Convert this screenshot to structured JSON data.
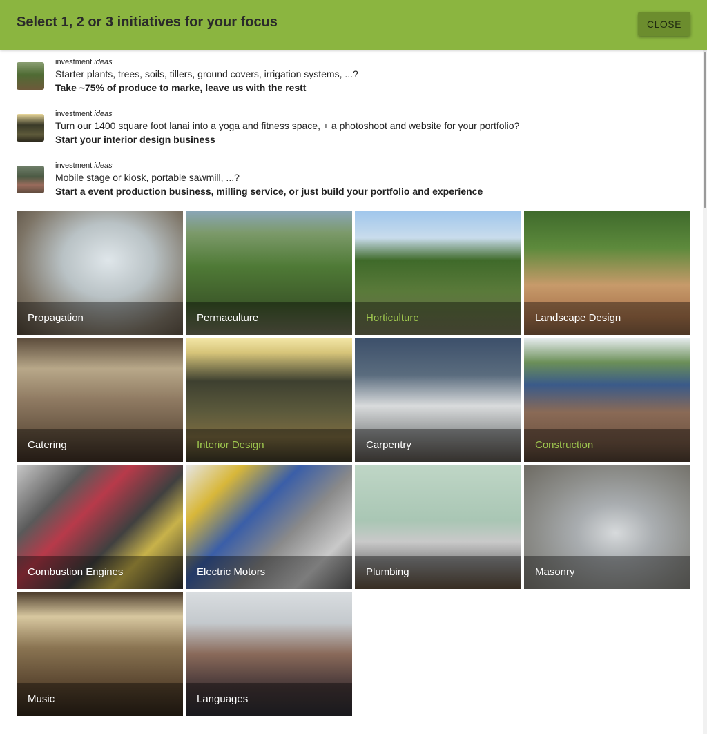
{
  "dialog": {
    "title": "Select 1, 2 or 3 initiatives for your focus",
    "close_label": "CLOSE",
    "accent_color": "#8bb540"
  },
  "ideas": [
    {
      "kicker": "investment",
      "kicker_em": "ideas",
      "line": "Starter plants, trees, soils, tillers, ground covers, irrigation systems, ...?",
      "bold": "Take ~75% of produce to marke, leave us with the restt"
    },
    {
      "kicker": "investment",
      "kicker_em": "ideas",
      "line": "Turn our 1400 square foot lanai into a yoga and fitness space, + a photoshoot and website for your portfolio?",
      "bold": "Start your interior design business"
    },
    {
      "kicker": "investment",
      "kicker_em": "ideas",
      "line": "Mobile stage or kiosk, portable sawmill, ...?",
      "bold": "Start a event production business, milling service, or just build your portfolio and experience"
    }
  ],
  "tiles": [
    {
      "label": "Propagation",
      "highlighted": false
    },
    {
      "label": "Permaculture",
      "highlighted": false
    },
    {
      "label": "Horticulture",
      "highlighted": true
    },
    {
      "label": "Landscape Design",
      "highlighted": false
    },
    {
      "label": "Catering",
      "highlighted": false
    },
    {
      "label": "Interior Design",
      "highlighted": true
    },
    {
      "label": "Carpentry",
      "highlighted": false
    },
    {
      "label": "Construction",
      "highlighted": true
    },
    {
      "label": "Combustion Engines",
      "highlighted": false
    },
    {
      "label": "Electric Motors",
      "highlighted": false
    },
    {
      "label": "Plumbing",
      "highlighted": false
    },
    {
      "label": "Masonry",
      "highlighted": false
    },
    {
      "label": "Music",
      "highlighted": false
    },
    {
      "label": "Languages",
      "highlighted": false
    }
  ],
  "highlight_color": "#9fc84f"
}
